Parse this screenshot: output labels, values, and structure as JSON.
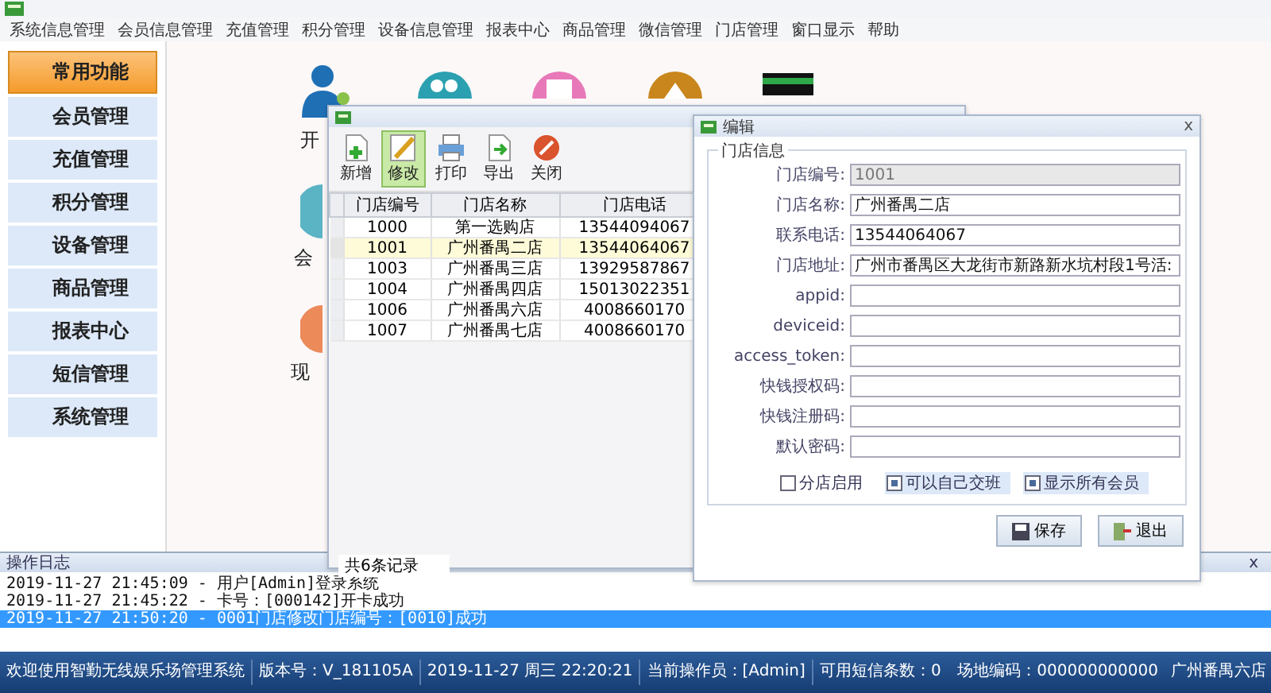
{
  "menu": [
    "系统信息管理",
    "会员信息管理",
    "充值管理",
    "积分管理",
    "设备信息管理",
    "报表中心",
    "商品管理",
    "微信管理",
    "门店管理",
    "窗口显示",
    "帮助"
  ],
  "sidebar": {
    "items": [
      {
        "label": "常用功能",
        "selected": true
      },
      {
        "label": "会员管理",
        "selected": false
      },
      {
        "label": "充值管理",
        "selected": false
      },
      {
        "label": "积分管理",
        "selected": false
      },
      {
        "label": "设备管理",
        "selected": false
      },
      {
        "label": "商品管理",
        "selected": false
      },
      {
        "label": "报表中心",
        "selected": false
      },
      {
        "label": "短信管理",
        "selected": false
      },
      {
        "label": "系统管理",
        "selected": false
      }
    ]
  },
  "desktop": {
    "labels": [
      "开",
      "会",
      "现"
    ]
  },
  "store_window": {
    "toolbar": [
      {
        "kind": "add",
        "label": "新增",
        "selected": false
      },
      {
        "kind": "edit",
        "label": "修改",
        "selected": true
      },
      {
        "kind": "print",
        "label": "打印",
        "selected": false
      },
      {
        "kind": "export",
        "label": "导出",
        "selected": false
      },
      {
        "kind": "close",
        "label": "关闭",
        "selected": false
      }
    ],
    "table": {
      "columns": [
        "门店编号",
        "门店名称",
        "门店电话"
      ],
      "rows": [
        {
          "cells": [
            "1000",
            "第一选购店",
            "13544094067"
          ],
          "selected": false
        },
        {
          "cells": [
            "1001",
            "广州番禺二店",
            "13544064067"
          ],
          "selected": true
        },
        {
          "cells": [
            "1003",
            "广州番禺三店",
            "13929587867"
          ],
          "selected": false
        },
        {
          "cells": [
            "1004",
            "广州番禺四店",
            "15013022351"
          ],
          "selected": false
        },
        {
          "cells": [
            "1006",
            "广州番禺六店",
            "4008660170"
          ],
          "selected": false
        },
        {
          "cells": [
            "1007",
            "广州番禺七店",
            "4008660170"
          ],
          "selected": false
        }
      ]
    },
    "record_count": "共6条记录"
  },
  "edit_dialog": {
    "title": "编辑",
    "close": "x",
    "group_title": "门店信息",
    "fields": [
      {
        "label": "门店编号:",
        "value": "1001",
        "disabled": true
      },
      {
        "label": "门店名称:",
        "value": "广州番禺二店",
        "disabled": false
      },
      {
        "label": "联系电话:",
        "value": "13544064067",
        "disabled": false
      },
      {
        "label": "门店地址:",
        "value": "广州市番禺区大龙街市新路新水坑村段1号活:",
        "disabled": false
      },
      {
        "label": "appid:",
        "disabled": false
      },
      {
        "label": "deviceid:",
        "disabled": false
      },
      {
        "label": "access_token:",
        "disabled": false
      },
      {
        "label": "快钱授权码:",
        "disabled": false
      },
      {
        "label": "快钱注册码:",
        "disabled": false
      },
      {
        "label": "默认密码:",
        "disabled": false
      }
    ],
    "checkboxes": [
      {
        "label": "分店启用",
        "checked": false
      },
      {
        "label": "可以自己交班",
        "checked": true
      },
      {
        "label": "显示所有会员",
        "checked": true
      }
    ],
    "buttons": [
      {
        "kind": "save",
        "label": "保存"
      },
      {
        "kind": "exit",
        "label": "退出"
      }
    ]
  },
  "log": {
    "title": "操作日志",
    "close": "x",
    "lines": [
      {
        "text": "2019-11-27 21:45:09 - 用户[Admin]登录系统",
        "selected": false
      },
      {
        "text": "2019-11-27 21:45:22 - 卡号：[000142]开卡成功",
        "selected": false
      },
      {
        "text": "2019-11-27 21:50:20 - 0001门店修改门店编号：[0010]成功",
        "selected": true
      }
    ]
  },
  "status_bar": [
    "欢迎使用智勤无线娱乐场管理系统",
    "版本号：V_181105A",
    "2019-11-27 周三 22:20:21",
    "当前操作员：[Admin]",
    "可用短信条数：0",
    "场地编码：000000000000",
    "广州番禺六店"
  ]
}
